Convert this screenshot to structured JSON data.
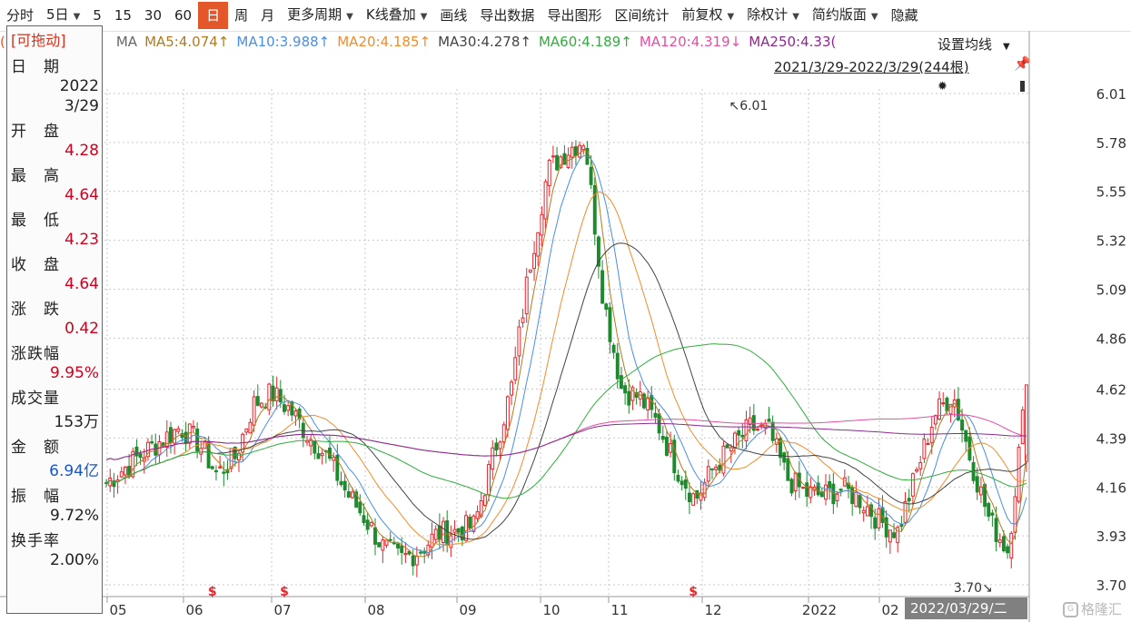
{
  "toolbar": {
    "items": [
      "分时",
      "5日",
      "5",
      "15",
      "30",
      "60",
      "日",
      "周",
      "月",
      "更多周期",
      "K线叠加",
      "画线",
      "导出数据",
      "导出图形",
      "区间统计",
      "前复权",
      "除权计",
      "简约版面",
      "隐藏"
    ],
    "active": "日",
    "dropdowns": [
      "5日",
      "更多周期",
      "K线叠加",
      "前复权",
      "除权计",
      "简约版面"
    ]
  },
  "ma_legend": {
    "prefix": "(",
    "ma_label": "MA",
    "items": [
      {
        "label": "MA5:4.074↑",
        "color": "#b07a1e"
      },
      {
        "label": "MA10:3.988↑",
        "color": "#4a8fe0"
      },
      {
        "label": "MA20:4.185↑",
        "color": "#f08c2a"
      },
      {
        "label": "MA30:4.278↑",
        "color": "#444444"
      },
      {
        "label": "MA60:4.189↑",
        "color": "#2fae3c"
      },
      {
        "label": "MA120:4.319↓",
        "color": "#e34fa0"
      },
      {
        "label": "MA250:4.33(",
        "color": "#8a2a8e"
      }
    ]
  },
  "info_panel": {
    "drag_label": "[可拖动]",
    "rows": [
      {
        "label": "日　期",
        "value": "2022",
        "value2": "3/29",
        "color": "dark"
      },
      {
        "label": "开　盘",
        "value": "4.28",
        "color": "red"
      },
      {
        "label": "最　高",
        "value": "4.64",
        "color": "red"
      },
      {
        "label": "最　低",
        "value": "4.23",
        "color": "red"
      },
      {
        "label": "收　盘",
        "value": "4.64",
        "color": "red"
      },
      {
        "label": "涨　跌",
        "value": "0.42",
        "color": "red"
      },
      {
        "label": "涨跌幅",
        "value": "9.95%",
        "color": "red"
      },
      {
        "label": "成交量",
        "value": "153万",
        "color": "dark"
      },
      {
        "label": "金　额",
        "value": "6.94亿",
        "color": "blue"
      },
      {
        "label": "振　幅",
        "value": "9.72%",
        "color": "dark"
      },
      {
        "label": "换手率",
        "value": "2.00%",
        "color": "dark"
      }
    ]
  },
  "ma_setting_label": "设置均线",
  "date_range": "2021/3/29-2022/3/29(244根)",
  "cursor_date": "2022/03/29/二",
  "watermark": "格隆汇",
  "colors": {
    "up": "#e8242b",
    "down": "#1e8a2e",
    "grid": "#c9c9c9",
    "active_tab": "#e2582b",
    "marker": "#e8242b"
  },
  "chart_data": {
    "type": "candlestick",
    "title": "",
    "ylim": [
      3.65,
      6.06
    ],
    "y_ticks": [
      "6.01",
      "5.78",
      "5.55",
      "5.32",
      "5.09",
      "4.86",
      "4.62",
      "4.39",
      "4.16",
      "3.93",
      "3.70"
    ],
    "x_ticks": [
      "05",
      "06",
      "07",
      "08",
      "09",
      "10",
      "11",
      "12",
      "2022",
      "02"
    ],
    "annotations": [
      {
        "label": "6.01",
        "arrow": "↖",
        "bar": 163
      },
      {
        "label": "3.70",
        "arrow": "↘",
        "bar": 236
      }
    ],
    "markers": {
      "symbol": "$",
      "bars": [
        28,
        47,
        155
      ]
    },
    "weekly_close": [
      4.18,
      4.25,
      4.32,
      4.38,
      4.44,
      4.37,
      4.22,
      4.3,
      4.55,
      4.6,
      4.52,
      4.4,
      4.3,
      4.14,
      4.02,
      3.88,
      3.82,
      3.86,
      3.94,
      3.95,
      3.98,
      4.3,
      4.62,
      5.2,
      5.65,
      5.74,
      5.8,
      5.05,
      4.62,
      4.58,
      4.45,
      4.25,
      4.1,
      4.25,
      4.35,
      4.44,
      4.42,
      4.2,
      4.13,
      4.12,
      4.15,
      4.1,
      4.0,
      3.95,
      4.22,
      4.5,
      4.6,
      4.28,
      4.0,
      3.86,
      4.64
    ],
    "series": [
      {
        "name": "MA5",
        "color": "#b07a1e",
        "last": 4.074
      },
      {
        "name": "MA10",
        "color": "#4a8fe0",
        "last": 3.988
      },
      {
        "name": "MA20",
        "color": "#f08c2a",
        "last": 4.185
      },
      {
        "name": "MA30",
        "color": "#444444",
        "last": 4.278
      },
      {
        "name": "MA60",
        "color": "#2fae3c",
        "last": 4.189
      },
      {
        "name": "MA120",
        "color": "#e34fa0",
        "last": 4.319
      },
      {
        "name": "MA250",
        "color": "#8a2a8e",
        "last": 4.33
      }
    ],
    "last_bar": {
      "open": 4.28,
      "high": 4.64,
      "low": 4.23,
      "close": 4.64,
      "change": 0.42,
      "pct": "9.95%"
    }
  }
}
